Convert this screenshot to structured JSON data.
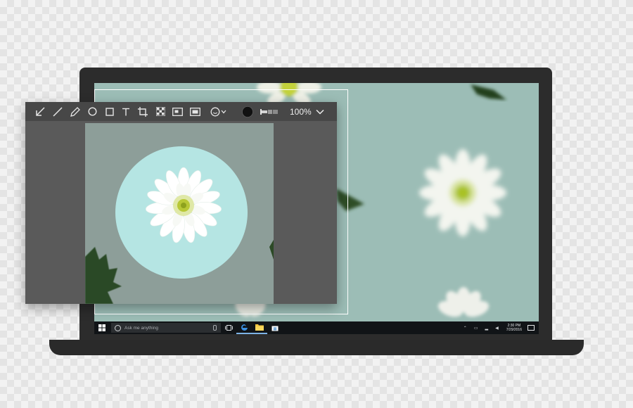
{
  "snip_editor": {
    "tools": [
      "select-arrow",
      "pen",
      "highlighter",
      "ellipse",
      "rectangle",
      "text",
      "crop",
      "pixelate",
      "screenshot-window",
      "screenshot-region",
      "emoji",
      "color",
      "thickness"
    ],
    "zoom_label": "100%",
    "selected_color": "#111111"
  },
  "taskbar": {
    "search_placeholder": "Ask me anything",
    "clock_time": "2:30 PM",
    "clock_date": "7/29/2016"
  },
  "colors": {
    "wallpaper": "#9cbdb6",
    "canvas": "#8d9e99",
    "circle_highlight": "#b5e5e3",
    "toolbar": "#474747",
    "window": "#5a5a5a",
    "taskbar": "#111417",
    "accent": "#7db3e6"
  }
}
